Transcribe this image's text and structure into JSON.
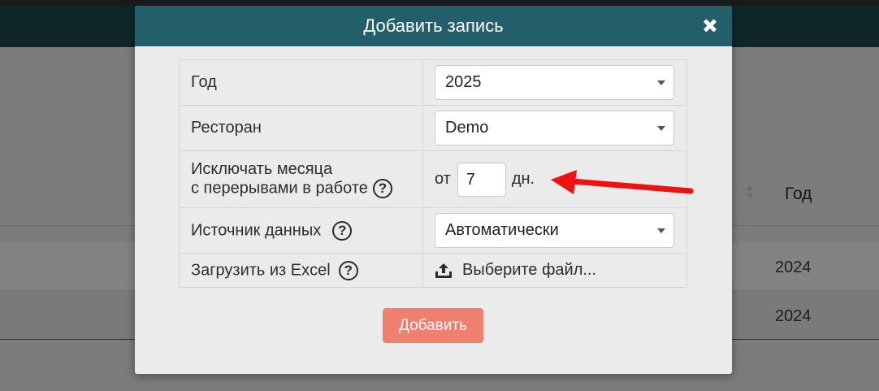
{
  "modal": {
    "title": "Добавить запись",
    "close_icon": "close-icon"
  },
  "form": {
    "year": {
      "label": "Год",
      "value": "2025"
    },
    "restaurant": {
      "label": "Ресторан",
      "value": "Demo"
    },
    "exclude_months": {
      "label_line1": "Исключать месяца",
      "label_line2": "с перерывами в работе",
      "prefix": "от",
      "value": "7",
      "suffix": "дн."
    },
    "data_source": {
      "label": "Источник данных",
      "value": "Автоматически"
    },
    "excel_upload": {
      "label": "Загрузить из Excel",
      "button_label": "Выберите файл..."
    },
    "submit_label": "Добавить",
    "help_glyph": "?"
  },
  "background_table": {
    "column_header": "Год",
    "rows": [
      "2024",
      "2024"
    ]
  },
  "colors": {
    "modal_header": "#235f6a",
    "submit_button": "#ef7f6f",
    "annotation_arrow": "#ee1111"
  }
}
